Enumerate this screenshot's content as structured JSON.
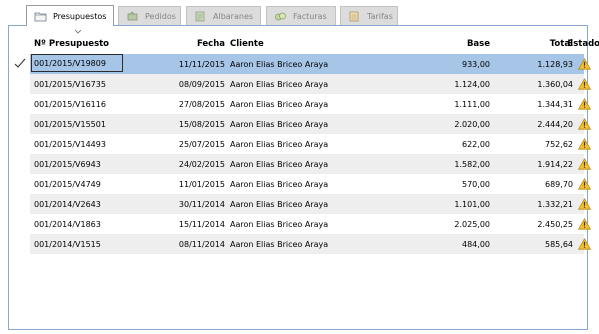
{
  "tabs": [
    {
      "label": "Presupuestos",
      "icon": "folder-icon",
      "active": true
    },
    {
      "label": "Pedidos",
      "icon": "cart-icon",
      "active": false
    },
    {
      "label": "Albaranes",
      "icon": "delivery-note-icon",
      "active": false
    },
    {
      "label": "Facturas",
      "icon": "invoice-icon",
      "active": false
    },
    {
      "label": "Tarifas",
      "icon": "price-list-icon",
      "active": false
    }
  ],
  "table": {
    "headers": {
      "numero": "Nº Presupuesto",
      "fecha": "Fecha",
      "cliente": "Cliente",
      "base": "Base",
      "total": "Total",
      "estado": "Estado"
    },
    "rows": [
      {
        "numero": "001/2015/V19809",
        "fecha": "11/11/2015",
        "cliente": "Aaron Elias Briceo Araya",
        "base": "933,00",
        "total": "1.128,93",
        "estado": "warning-icon"
      },
      {
        "numero": "001/2015/V16735",
        "fecha": "08/09/2015",
        "cliente": "Aaron Elias Briceo Araya",
        "base": "1.124,00",
        "total": "1.360,04",
        "estado": "warning-icon"
      },
      {
        "numero": "001/2015/V16116",
        "fecha": "27/08/2015",
        "cliente": "Aaron Elias Briceo Araya",
        "base": "1.111,00",
        "total": "1.344,31",
        "estado": "warning-icon"
      },
      {
        "numero": "001/2015/V15501",
        "fecha": "15/08/2015",
        "cliente": "Aaron Elias Briceo Araya",
        "base": "2.020,00",
        "total": "2.444,20",
        "estado": "warning-icon"
      },
      {
        "numero": "001/2015/V14493",
        "fecha": "25/07/2015",
        "cliente": "Aaron Elias Briceo Araya",
        "base": "622,00",
        "total": "752,62",
        "estado": "warning-icon"
      },
      {
        "numero": "001/2015/V6943",
        "fecha": "24/02/2015",
        "cliente": "Aaron Elias Briceo Araya",
        "base": "1.582,00",
        "total": "1.914,22",
        "estado": "warning-icon"
      },
      {
        "numero": "001/2015/V4749",
        "fecha": "11/01/2015",
        "cliente": "Aaron Elias Briceo Araya",
        "base": "570,00",
        "total": "689,70",
        "estado": "warning-icon"
      },
      {
        "numero": "001/2014/V2643",
        "fecha": "30/11/2014",
        "cliente": "Aaron Elias Briceo Araya",
        "base": "1.101,00",
        "total": "1.332,21",
        "estado": "warning-icon"
      },
      {
        "numero": "001/2014/V1863",
        "fecha": "15/11/2014",
        "cliente": "Aaron Elias Briceo Araya",
        "base": "2.025,00",
        "total": "2.450,25",
        "estado": "warning-icon"
      },
      {
        "numero": "001/2014/V1515",
        "fecha": "08/11/2014",
        "cliente": "Aaron Elias Briceo Araya",
        "base": "484,00",
        "total": "585,64",
        "estado": "warning-icon"
      }
    ]
  },
  "colors": {
    "selected_row": "#a7c5e7",
    "alt_row": "#eeeeee",
    "panel_border": "#86a7d1",
    "warning": "#f2c230"
  }
}
